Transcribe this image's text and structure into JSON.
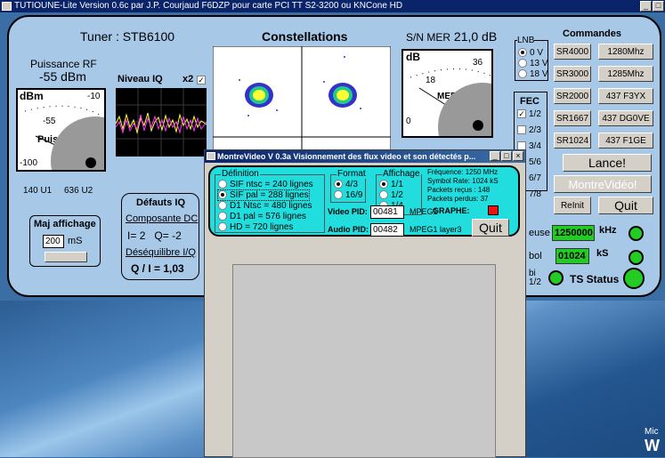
{
  "window": {
    "title": "TUTIOUNE-Lite  Version 0.6c par J.P. Courjaud F6DZP  pour carte PCI TT S2-3200 ou KNCone HD"
  },
  "tuner": {
    "label": "Tuner : STB6100"
  },
  "puissance": {
    "title": "Puissance RF",
    "value": "-55 dBm",
    "unit": "dBm",
    "tick_top": "-10",
    "tick_mid": "-55",
    "tick_bottom": "-100",
    "needle_label": "Puissance",
    "u1": "140 U1",
    "u2": "636 U2",
    "level_db": -55
  },
  "niveau_iq": {
    "label": "Niveau IQ",
    "x2_label": "x2",
    "x2_checked": true
  },
  "constellations": {
    "label": "Constellations"
  },
  "snr": {
    "label": "S/N MER",
    "value": "21,0 dB",
    "unit": "dB",
    "tick_top": "36",
    "tick_mid": "18",
    "tick_bottom": "0",
    "needle_label": "MER",
    "level_db": 21.0
  },
  "defauts": {
    "title": "Défauts IQ",
    "dc_label": "Composante DC",
    "i_label": "I=",
    "i_value": "2",
    "q_label": "Q=",
    "q_value": "-2",
    "deseq_label": "Déséquilibre I/Q",
    "qi_label": "Q / I =",
    "qi_value": "1,03"
  },
  "maj": {
    "title": "Maj affichage",
    "value": "200",
    "unit": "mS"
  },
  "lnb": {
    "label": "LNB",
    "options": [
      "0 V",
      "13 V",
      "18 V"
    ],
    "selected": 0
  },
  "fec": {
    "label": "FEC",
    "options": [
      "1/2",
      "2/3",
      "3/4",
      "5/6",
      "6/7",
      "7/8"
    ],
    "checked": [
      true,
      false,
      false,
      false,
      false,
      false
    ]
  },
  "commandes": {
    "title": "Commandes",
    "sr": [
      "SR4000",
      "SR3000",
      "SR2000",
      "SR1667",
      "SR1024"
    ],
    "freq": [
      "1280Mhz",
      "1285Mhz",
      "437 F3YX",
      "437 DG0VE",
      "437 F1GE"
    ],
    "lance": "Lance!",
    "montrevideo": "MontreVidéo!",
    "reinit": "ReInit",
    "quit": "Quit"
  },
  "status": {
    "freq_label": "euse",
    "freq_value": "1250000",
    "freq_unit": "kHz",
    "sym_label": "bol",
    "sym_value": "01024",
    "sym_unit": "kS",
    "fec_label_a": "bi",
    "fec_label_b": "1/2",
    "ts_label": "TS Status"
  },
  "dialog": {
    "title": "MontreVideo V 0.3a   Visionnement des flux video et son détectés p...",
    "definition_label": "Définition",
    "definition_options": [
      "SIF ntsc = 240 lignes",
      "SIF pal = 288 lignes",
      "D1 Ntsc = 480 lignes",
      "D1 pal = 576 lignes",
      "HD = 720 lignes"
    ],
    "definition_selected": 1,
    "format_label": "Format",
    "format_options": [
      "4/3",
      "16/9"
    ],
    "format_selected": 0,
    "affichage_label": "Affichage",
    "affichage_options": [
      "1/1",
      "1/2",
      "1/4"
    ],
    "affichage_selected": 0,
    "info": [
      "Fréquence: 1250 MHz",
      "Symbol Rate: 1024 kS",
      "Packets reçus :  148",
      "Packets perdus: 37"
    ],
    "graphe_label": "GRAPHE:",
    "video_pid_label": "Video PID:",
    "video_pid": "00481",
    "video_codec": "MPEG1",
    "audio_pid_label": "Audio PID:",
    "audio_pid": "00482",
    "audio_codec": "MPEG1 layer3",
    "quit": "Quit"
  },
  "desktop": {
    "watermark_a": "Mic",
    "watermark_b": "W"
  }
}
